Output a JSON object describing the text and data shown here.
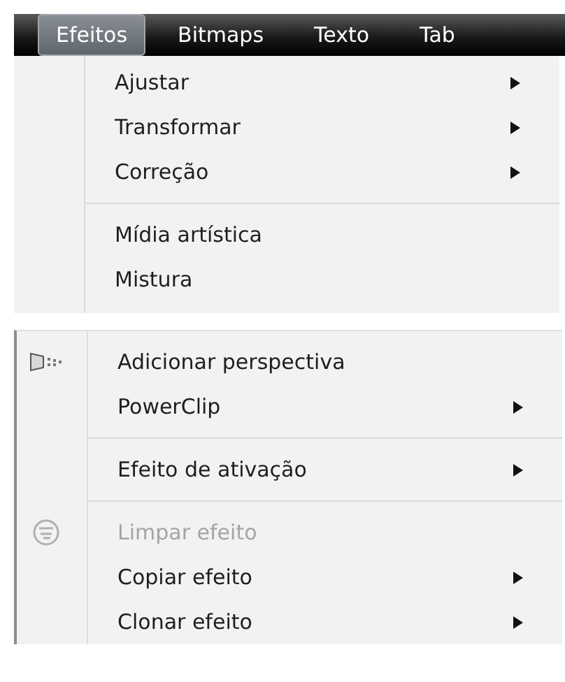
{
  "menubar": [
    {
      "label": "Efeitos",
      "selected": true
    },
    {
      "label": "Bitmaps",
      "selected": false
    },
    {
      "label": "Texto",
      "selected": false
    },
    {
      "label": "Tab",
      "selected": false
    }
  ],
  "panels": [
    {
      "groups": [
        [
          {
            "kind": "plain",
            "label": "Ajustar",
            "submenu": true,
            "disabled": false
          },
          {
            "kind": "plain",
            "label": "Transformar",
            "submenu": true,
            "disabled": false
          },
          {
            "kind": "plain",
            "label": "Correção",
            "submenu": true,
            "disabled": false
          }
        ],
        [
          {
            "kind": "plain",
            "label": "Mídia artística",
            "submenu": false,
            "disabled": false
          },
          {
            "kind": "plain",
            "label": "Mistura",
            "submenu": false,
            "disabled": false
          }
        ]
      ]
    },
    {
      "groups": [
        [
          {
            "kind": "perspective",
            "label": "Adicionar perspectiva",
            "submenu": false,
            "disabled": false
          },
          {
            "kind": "plain",
            "label": "PowerClip",
            "submenu": true,
            "disabled": false
          }
        ],
        [
          {
            "kind": "plain",
            "label": "Efeito de ativação",
            "submenu": true,
            "disabled": false
          }
        ],
        [
          {
            "kind": "clear-effect",
            "label": "Limpar efeito",
            "submenu": false,
            "disabled": true
          },
          {
            "kind": "plain",
            "label": "Copiar efeito",
            "submenu": true,
            "disabled": false
          },
          {
            "kind": "plain",
            "label": "Clonar efeito",
            "submenu": true,
            "disabled": false
          }
        ]
      ]
    }
  ]
}
